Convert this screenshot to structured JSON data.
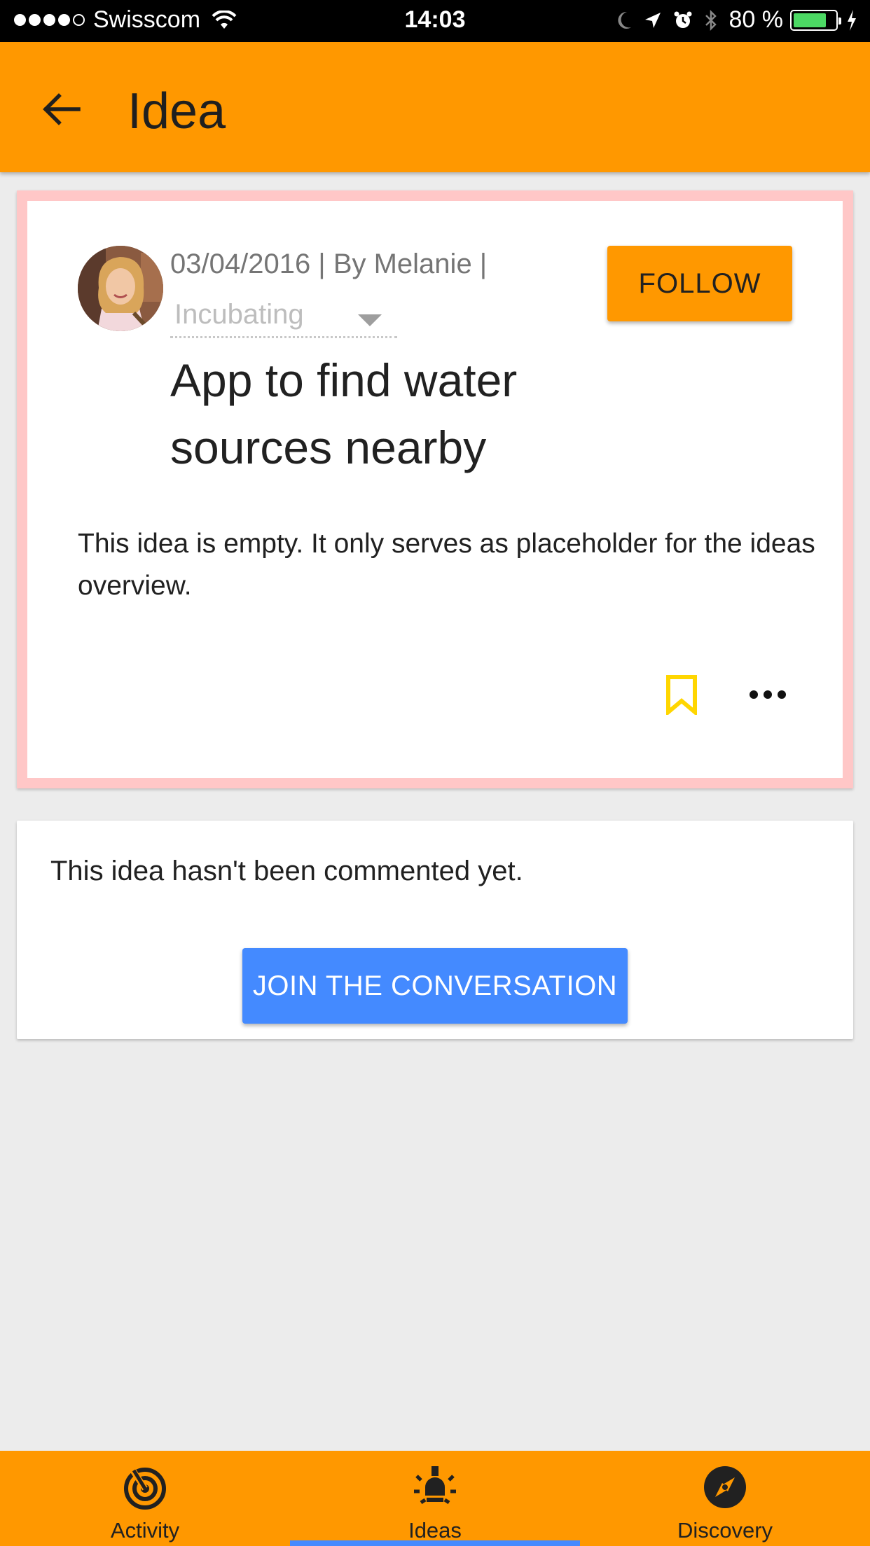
{
  "status_bar": {
    "carrier": "Swisscom",
    "time": "14:03",
    "battery": "80 %",
    "battery_level": 0.8
  },
  "app_bar": {
    "back_icon": "arrow-back-icon",
    "title": "Idea"
  },
  "idea": {
    "meta": "03/04/2016 | By Melanie |",
    "status": "Incubating",
    "title": "App to find water sources nearby",
    "follow_label": "FOLLOW",
    "description": "This idea is empty. It only serves as placeholder for the ideas overview.",
    "bookmark_icon": "bookmark-icon",
    "more_icon": "more-horizontal-icon"
  },
  "comments": {
    "empty_message": "This idea hasn't been commented yet.",
    "join_label": "JOIN THE CONVERSATION"
  },
  "bottom_nav": {
    "items": [
      {
        "label": "Activity",
        "icon": "activity-radar-icon",
        "active": false
      },
      {
        "label": "Ideas",
        "icon": "lightbulb-icon",
        "active": true
      },
      {
        "label": "Discovery",
        "icon": "compass-icon",
        "active": false
      }
    ]
  },
  "colors": {
    "primary": "#ff9800",
    "accent": "#448aff",
    "card_border": "#ffc7c7",
    "bookmark": "#ffd600"
  }
}
